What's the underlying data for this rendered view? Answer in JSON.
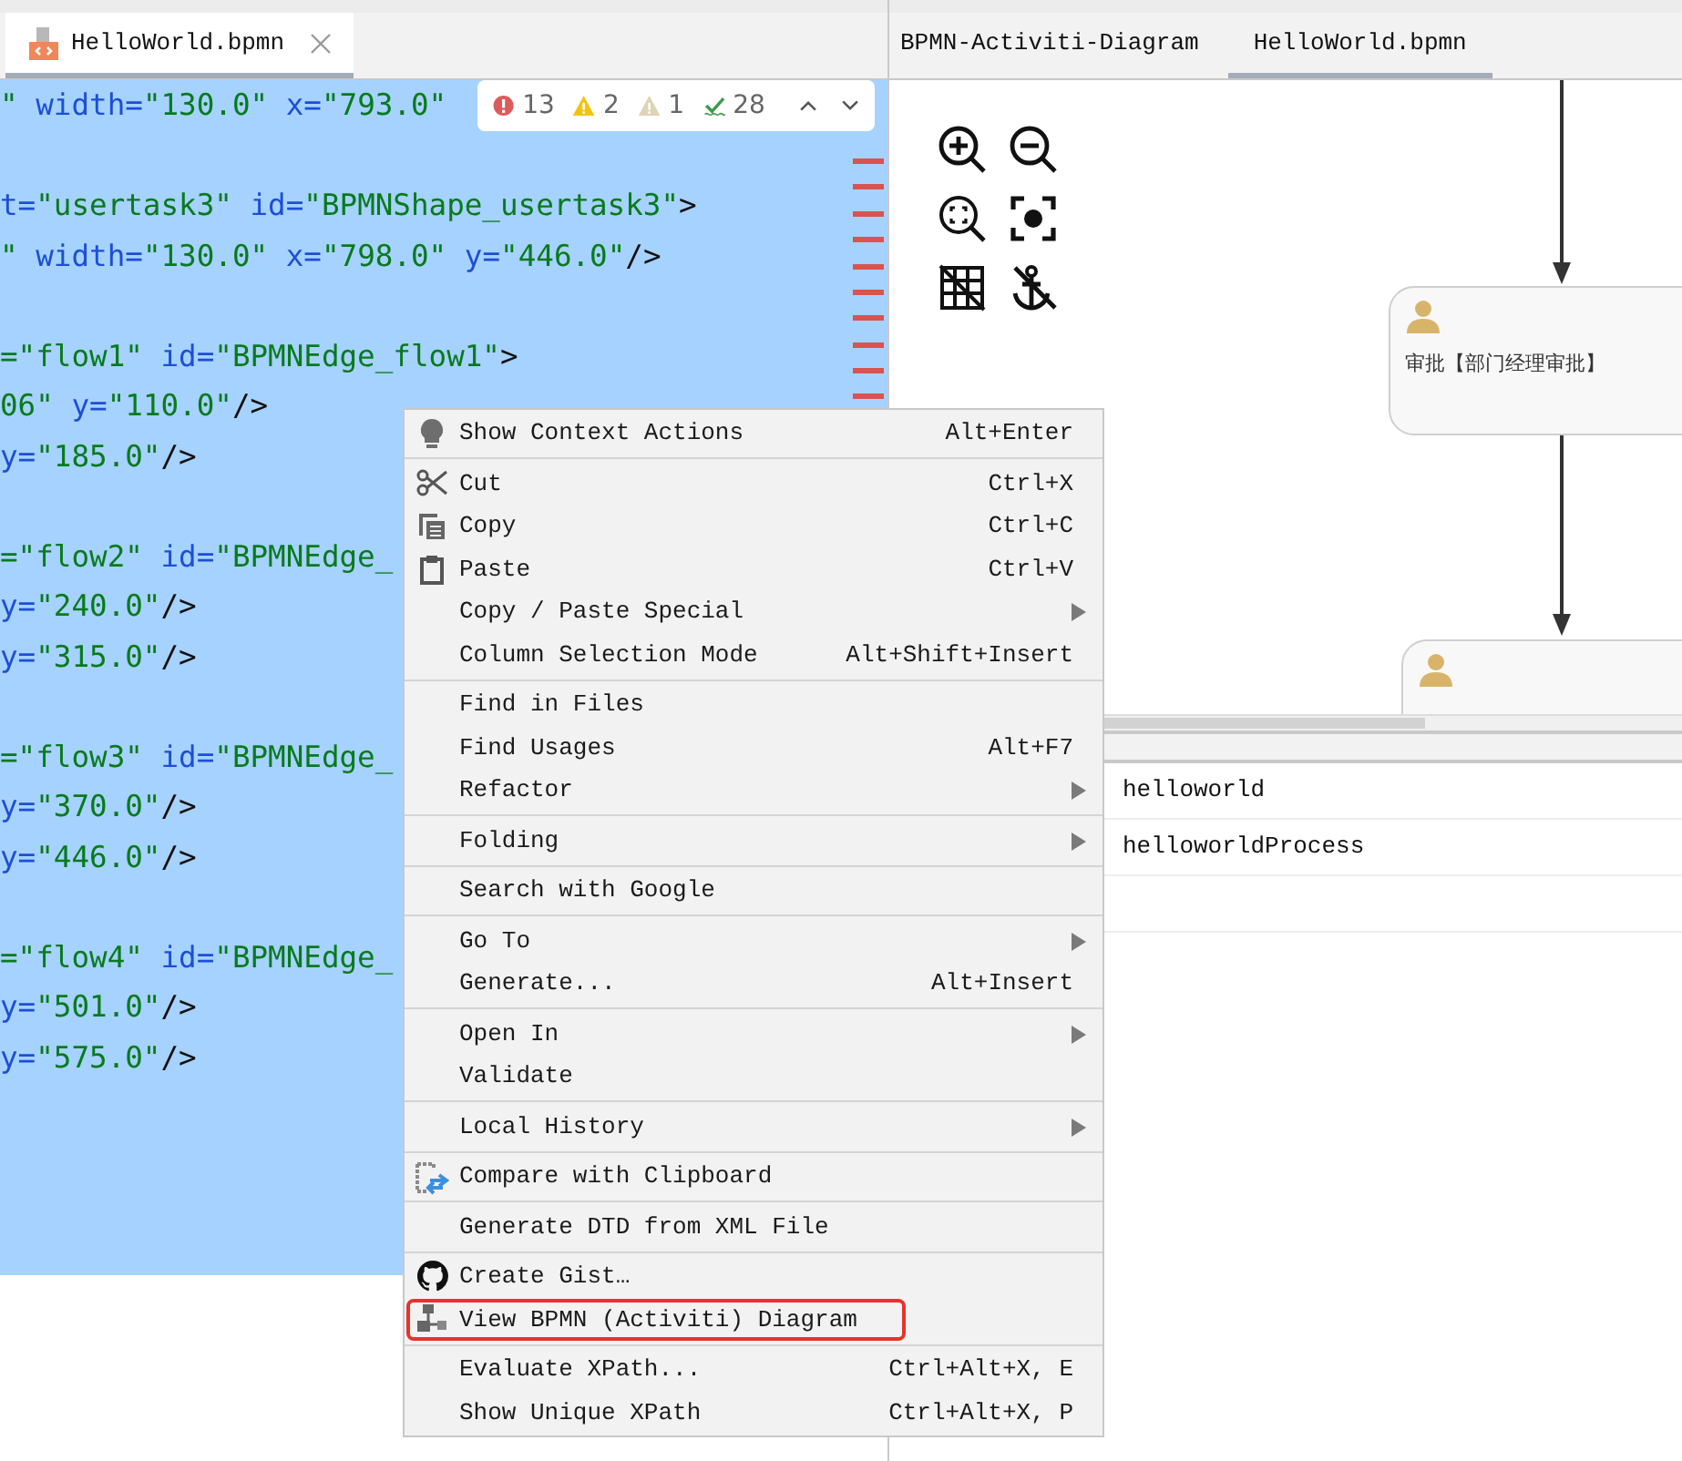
{
  "editor": {
    "tab": {
      "label": "HelloWorld.bpmn",
      "selected": true
    },
    "inspection": {
      "errors": "13",
      "warnings": "2",
      "weak_warnings": "1",
      "passed": "28"
    },
    "lines": [
      {
        "kind": "code",
        "tokens": [
          {
            "kind": "value",
            "text": "\""
          },
          {
            "kind": "attr",
            "text": " width="
          },
          {
            "kind": "value",
            "text": "\"130.0\""
          },
          {
            "kind": "attr",
            "text": " x="
          },
          {
            "kind": "value",
            "text": "\"793.0\""
          }
        ]
      },
      {
        "kind": "blank"
      },
      {
        "kind": "code",
        "tokens": [
          {
            "kind": "attr",
            "text": "t="
          },
          {
            "kind": "value",
            "text": "\"usertask3\""
          },
          {
            "kind": "attr",
            "text": " id="
          },
          {
            "kind": "value",
            "text": "\"BPMNShape_usertask3\""
          },
          {
            "kind": "tag",
            "text": ">"
          }
        ]
      },
      {
        "kind": "code",
        "tokens": [
          {
            "kind": "value",
            "text": "\""
          },
          {
            "kind": "attr",
            "text": " width="
          },
          {
            "kind": "value",
            "text": "\"130.0\""
          },
          {
            "kind": "attr",
            "text": " x="
          },
          {
            "kind": "value",
            "text": "\"798.0\""
          },
          {
            "kind": "attr",
            "text": " y="
          },
          {
            "kind": "value",
            "text": "\"446.0\""
          },
          {
            "kind": "tag",
            "text": "/>"
          }
        ]
      },
      {
        "kind": "blank"
      },
      {
        "kind": "code",
        "tokens": [
          {
            "kind": "value",
            "text": "=\"flow1\""
          },
          {
            "kind": "attr",
            "text": " id="
          },
          {
            "kind": "value",
            "text": "\"BPMNEdge_flow1\""
          },
          {
            "kind": "tag",
            "text": ">"
          }
        ]
      },
      {
        "kind": "code",
        "tokens": [
          {
            "kind": "value",
            "text": "06\""
          },
          {
            "kind": "attr",
            "text": " y="
          },
          {
            "kind": "value",
            "text": "\"110.0\""
          },
          {
            "kind": "tag",
            "text": "/>"
          }
        ]
      },
      {
        "kind": "code",
        "tokens": [
          {
            "kind": "attr",
            "text": "y="
          },
          {
            "kind": "value",
            "text": "\"185.0\""
          },
          {
            "kind": "tag",
            "text": "/>"
          }
        ]
      },
      {
        "kind": "blank"
      },
      {
        "kind": "code",
        "tokens": [
          {
            "kind": "value",
            "text": "=\"flow2\""
          },
          {
            "kind": "attr",
            "text": " id="
          },
          {
            "kind": "value",
            "text": "\"BPMNEdge_"
          }
        ]
      },
      {
        "kind": "code",
        "tokens": [
          {
            "kind": "attr",
            "text": "y="
          },
          {
            "kind": "value",
            "text": "\"240.0\""
          },
          {
            "kind": "tag",
            "text": "/>"
          }
        ]
      },
      {
        "kind": "code",
        "tokens": [
          {
            "kind": "attr",
            "text": "y="
          },
          {
            "kind": "value",
            "text": "\"315.0\""
          },
          {
            "kind": "tag",
            "text": "/>"
          }
        ]
      },
      {
        "kind": "blank"
      },
      {
        "kind": "code",
        "tokens": [
          {
            "kind": "value",
            "text": "=\"flow3\""
          },
          {
            "kind": "attr",
            "text": " id="
          },
          {
            "kind": "value",
            "text": "\"BPMNEdge_"
          }
        ]
      },
      {
        "kind": "code",
        "tokens": [
          {
            "kind": "attr",
            "text": "y="
          },
          {
            "kind": "value",
            "text": "\"370.0\""
          },
          {
            "kind": "tag",
            "text": "/>"
          }
        ]
      },
      {
        "kind": "code",
        "tokens": [
          {
            "kind": "attr",
            "text": "y="
          },
          {
            "kind": "value",
            "text": "\"446.0\""
          },
          {
            "kind": "tag",
            "text": "/>"
          }
        ]
      },
      {
        "kind": "blank"
      },
      {
        "kind": "code",
        "tokens": [
          {
            "kind": "value",
            "text": "=\"flow4\""
          },
          {
            "kind": "attr",
            "text": " id="
          },
          {
            "kind": "value",
            "text": "\"BPMNEdge_"
          }
        ]
      },
      {
        "kind": "code",
        "tokens": [
          {
            "kind": "attr",
            "text": "y="
          },
          {
            "kind": "value",
            "text": "\"501.0\""
          },
          {
            "kind": "tag",
            "text": "/>"
          }
        ]
      },
      {
        "kind": "code",
        "tokens": [
          {
            "kind": "attr",
            "text": "y="
          },
          {
            "kind": "value",
            "text": "\"575.0\""
          },
          {
            "kind": "tag",
            "text": "/>"
          }
        ]
      }
    ]
  },
  "diagram": {
    "tabs": [
      {
        "label": "BPMN-Activiti-Diagram",
        "selected": false
      },
      {
        "label": "HelloWorld.bpmn",
        "selected": true
      }
    ],
    "nodes": [
      {
        "kind": "user_task",
        "label": "审批【部门经理审批】"
      },
      {
        "kind": "user_task_clipped"
      }
    ]
  },
  "properties": {
    "rows": [
      {
        "value": "helloworld"
      },
      {
        "value": "helloworldProcess"
      }
    ]
  },
  "context_menu": {
    "items": [
      {
        "kind": "action",
        "label": "Show Context Actions",
        "shortcut": "Alt+Enter",
        "has_submenu": false,
        "highlighted": false
      },
      {
        "kind": "separator"
      },
      {
        "kind": "action",
        "label": "Cut",
        "shortcut": "Ctrl+X",
        "has_submenu": false,
        "highlighted": false
      },
      {
        "kind": "action",
        "label": "Copy",
        "shortcut": "Ctrl+C",
        "has_submenu": false,
        "highlighted": false
      },
      {
        "kind": "action",
        "label": "Paste",
        "shortcut": "Ctrl+V",
        "has_submenu": false,
        "highlighted": false
      },
      {
        "kind": "action",
        "label": "Copy / Paste Special",
        "has_submenu": true,
        "highlighted": false
      },
      {
        "kind": "action",
        "label": "Column Selection Mode",
        "shortcut": "Alt+Shift+Insert",
        "has_submenu": false,
        "highlighted": false
      },
      {
        "kind": "separator"
      },
      {
        "kind": "action",
        "label": "Find in Files",
        "has_submenu": false,
        "highlighted": false
      },
      {
        "kind": "action",
        "label": "Find Usages",
        "shortcut": "Alt+F7",
        "has_submenu": false,
        "highlighted": false
      },
      {
        "kind": "action",
        "label": "Refactor",
        "has_submenu": true,
        "highlighted": false
      },
      {
        "kind": "separator"
      },
      {
        "kind": "action",
        "label": "Folding",
        "has_submenu": true,
        "highlighted": false
      },
      {
        "kind": "separator"
      },
      {
        "kind": "action",
        "label": "Search with Google",
        "has_submenu": false,
        "highlighted": false
      },
      {
        "kind": "separator"
      },
      {
        "kind": "action",
        "label": "Go To",
        "has_submenu": true,
        "highlighted": false
      },
      {
        "kind": "action",
        "label": "Generate...",
        "shortcut": "Alt+Insert",
        "has_submenu": false,
        "highlighted": false
      },
      {
        "kind": "separator"
      },
      {
        "kind": "action",
        "label": "Open In",
        "has_submenu": true,
        "highlighted": false
      },
      {
        "kind": "action",
        "label": "Validate",
        "has_submenu": false,
        "highlighted": false
      },
      {
        "kind": "separator"
      },
      {
        "kind": "action",
        "label": "Local History",
        "has_submenu": true,
        "highlighted": false
      },
      {
        "kind": "separator"
      },
      {
        "kind": "action",
        "label": "Compare with Clipboard",
        "has_submenu": false,
        "highlighted": false
      },
      {
        "kind": "separator"
      },
      {
        "kind": "action",
        "label": "Generate DTD from XML File",
        "has_submenu": false,
        "highlighted": false
      },
      {
        "kind": "separator"
      },
      {
        "kind": "action",
        "label": "Create Gist…",
        "has_submenu": false,
        "highlighted": false
      },
      {
        "kind": "action",
        "label": "View BPMN (Activiti) Diagram",
        "has_submenu": false,
        "highlighted": true
      },
      {
        "kind": "separator"
      },
      {
        "kind": "action",
        "label": "Evaluate XPath...",
        "shortcut": "Ctrl+Alt+X, E",
        "has_submenu": false,
        "highlighted": false
      },
      {
        "kind": "action",
        "label": "Show Unique XPath",
        "shortcut": "Ctrl+Alt+X, P",
        "has_submenu": false,
        "highlighted": false
      }
    ]
  }
}
